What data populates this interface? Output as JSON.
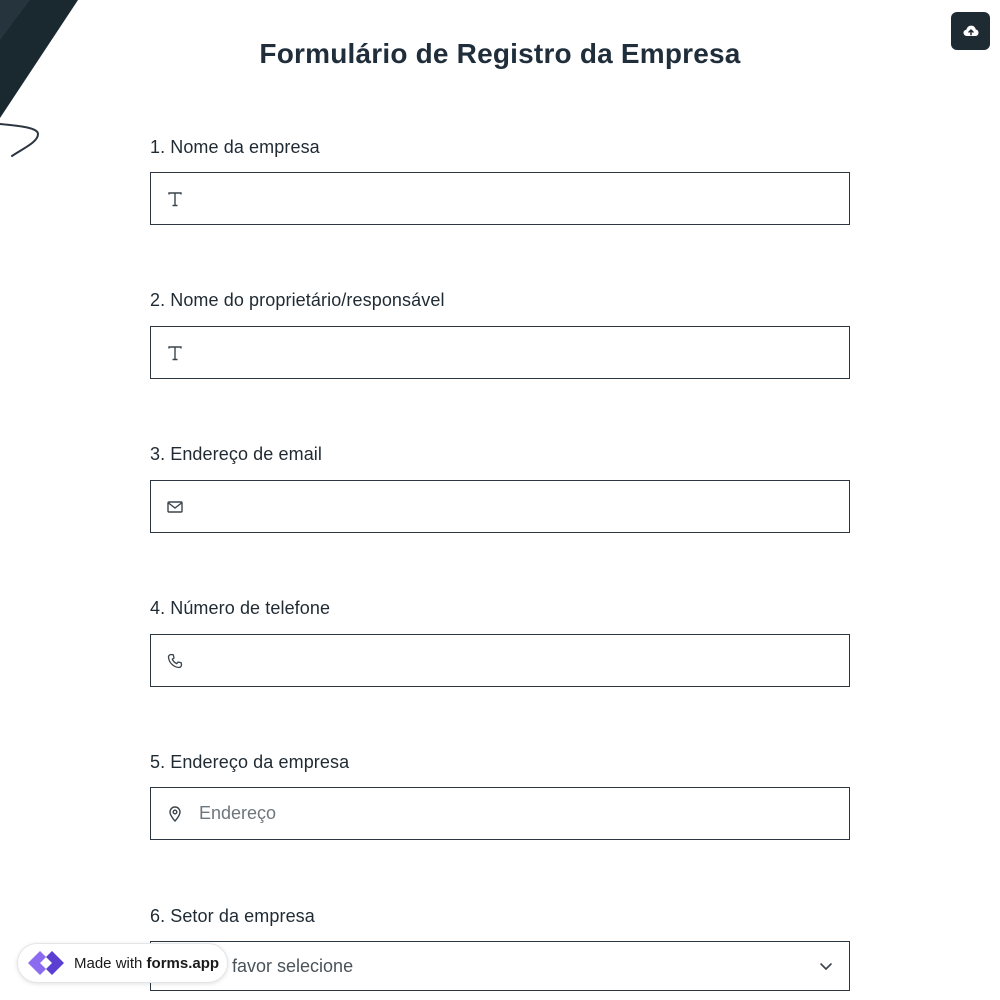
{
  "form": {
    "title": "Formulário de Registro da Empresa"
  },
  "questions": [
    {
      "number": "1.",
      "label": "Nome da empresa",
      "icon": "text-icon",
      "placeholder": ""
    },
    {
      "number": "2.",
      "label": "Nome do proprietário/responsável",
      "icon": "text-icon",
      "placeholder": ""
    },
    {
      "number": "3.",
      "label": "Endereço de email",
      "icon": "mail-icon",
      "placeholder": ""
    },
    {
      "number": "4.",
      "label": "Número de telefone",
      "icon": "phone-icon",
      "placeholder": ""
    },
    {
      "number": "5.",
      "label": "Endereço da empresa",
      "icon": "map-pin-icon",
      "placeholder": "Endereço"
    },
    {
      "number": "6.",
      "label": "Setor da empresa",
      "icon": "chevron-down-icon",
      "selected_text": "Por favor selecione"
    }
  ],
  "toolbar": {
    "upload_icon": "cloud-upload-icon"
  },
  "badge": {
    "prefix": "Made with",
    "brand": "forms.app"
  },
  "colors": {
    "dark": "#1e2b33",
    "border": "#2c3640",
    "brand_purple": "#6c4bd8"
  }
}
